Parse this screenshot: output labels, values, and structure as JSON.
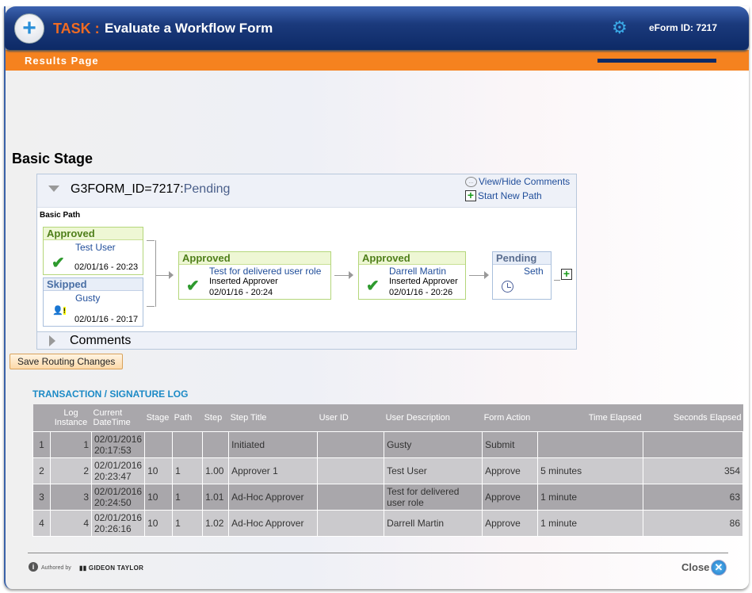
{
  "header": {
    "task_label": "TASK :",
    "task_title": "Evaluate a Workflow Form",
    "settings_icon": "gear-icon",
    "eform_id": "eForm ID: 7217",
    "subheader": "Results Page"
  },
  "stage": {
    "title": "Basic Stage",
    "form_id": "G3FORM_ID=7217:",
    "form_status": "Pending",
    "view_hide_comments": "View/Hide Comments",
    "start_new_path": "Start New Path",
    "path_label": "Basic Path",
    "nodes": [
      {
        "status": "Approved",
        "name": "Test User",
        "sub": "",
        "date": "02/01/16 - 20:23",
        "icon": "check-icon"
      },
      {
        "status": "Skipped",
        "name": "Gusty",
        "sub": "",
        "date": "02/01/16 - 20:17",
        "icon": "skipped-user-icon"
      },
      {
        "status": "Approved",
        "name": "Test for delivered user role",
        "sub": "Inserted Approver",
        "date": "02/01/16 - 20:24",
        "icon": "check-icon"
      },
      {
        "status": "Approved",
        "name": "Darrell Martin",
        "sub": "Inserted Approver",
        "date": "02/01/16 - 20:26",
        "icon": "check-icon"
      },
      {
        "status": "Pending",
        "name": "Seth",
        "sub": "",
        "date": "",
        "icon": "clock-icon"
      }
    ],
    "comments_label": "Comments"
  },
  "save_button": "Save Routing Changes",
  "log": {
    "title": "TRANSACTION / SIGNATURE LOG",
    "columns": [
      "",
      "Log Instance",
      "Current DateTime",
      "Stage",
      "Path",
      "Step",
      "Step Title",
      "User ID",
      "User Description",
      "Form Action",
      "Time Elapsed",
      "Seconds Elapsed"
    ],
    "rows": [
      {
        "row": "1",
        "instance": "1",
        "datetime": "02/01/2016 20:17:53",
        "stage": "",
        "path": "",
        "step": "",
        "title": "Initiated",
        "user_id": "",
        "user_desc": "Gusty",
        "action": "Submit",
        "elapsed": "",
        "seconds": ""
      },
      {
        "row": "2",
        "instance": "2",
        "datetime": "02/01/2016 20:23:47",
        "stage": "10",
        "path": "1",
        "step": "1.00",
        "title": "Approver 1",
        "user_id": "",
        "user_desc": "Test User",
        "action": "Approve",
        "elapsed": "5 minutes",
        "seconds": "354"
      },
      {
        "row": "3",
        "instance": "3",
        "datetime": "02/01/2016 20:24:50",
        "stage": "10",
        "path": "1",
        "step": "1.01",
        "title": "Ad-Hoc Approver",
        "user_id": "",
        "user_desc": "Test for delivered user role",
        "action": "Approve",
        "elapsed": "1 minute",
        "seconds": "63"
      },
      {
        "row": "4",
        "instance": "4",
        "datetime": "02/01/2016 20:26:16",
        "stage": "10",
        "path": "1",
        "step": "1.02",
        "title": "Ad-Hoc Approver",
        "user_id": "",
        "user_desc": "Darrell Martin",
        "action": "Approve",
        "elapsed": "1 minute",
        "seconds": "86"
      }
    ]
  },
  "footer": {
    "authored_by": "Authored by",
    "brand": "▮▮ GIDEON TAYLOR",
    "close_label": "Close"
  }
}
